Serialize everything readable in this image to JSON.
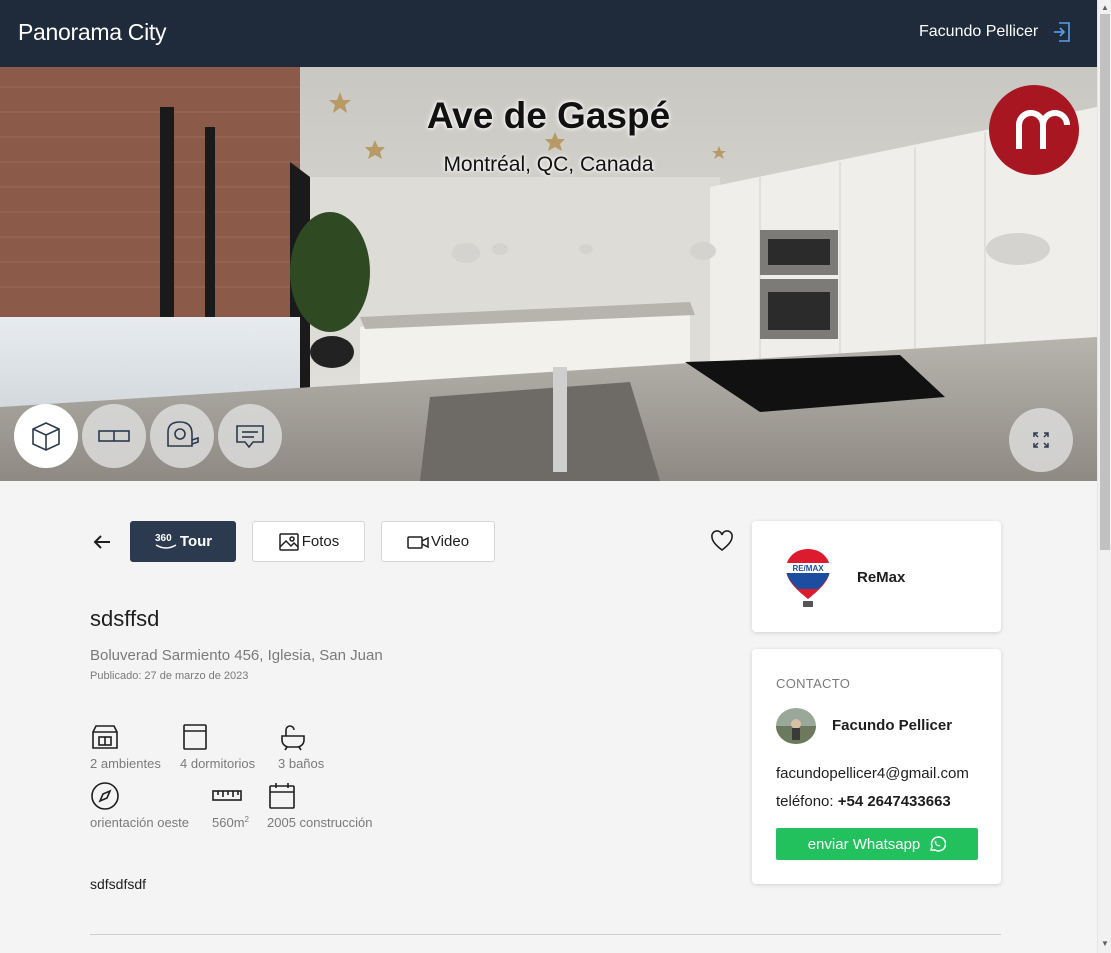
{
  "header": {
    "brand": "Panorama City",
    "user_name": "Facundo Pellicer",
    "logout_icon": "logout-icon"
  },
  "panorama": {
    "title": "Ave de Gaspé",
    "subtitle": "Montréal, QC, Canada",
    "controls": [
      {
        "name": "dollhouse-view-button",
        "icon": "cube-icon",
        "active": true
      },
      {
        "name": "floorplan-view-button",
        "icon": "floorplan-icon",
        "active": false
      },
      {
        "name": "measure-tool-button",
        "icon": "tape-measure-icon",
        "active": false
      },
      {
        "name": "annotations-button",
        "icon": "chat-icon",
        "active": false
      }
    ],
    "fullscreen_icon": "fullscreen-icon"
  },
  "tabs": {
    "tour_prefix": "360",
    "tour": "Tour",
    "photos": "Fotos",
    "video": "Video",
    "active": "tour"
  },
  "property": {
    "title": "sdsffsd",
    "address": "Boluverad Sarmiento 456, Iglesia, San Juan",
    "published": "Publicado: 27 de marzo de 2023",
    "features": {
      "ambientes": "2 ambientes",
      "dormitorios": "4 dormitorios",
      "banos": "3 baños",
      "orientacion": "orientación oeste",
      "superficie": "560m",
      "superficie_unit_sup": "2",
      "construccion": "2005 construcción"
    },
    "description": "sdfsdfsdf"
  },
  "agency": {
    "name": "ReMax",
    "logo_text": "RE/MAX"
  },
  "contact": {
    "heading": "CONTACTO",
    "name": "Facundo Pellicer",
    "email": "facundopellicer4@gmail.com",
    "phone_label": "teléfono: ",
    "phone": "+54 2647433663",
    "whatsapp_label": "enviar Whatsapp"
  },
  "colors": {
    "header_bg": "#1f2a3a",
    "active_tab": "#2b3a4e",
    "whatsapp": "#22c15e",
    "agency_logo": "#a81622"
  }
}
